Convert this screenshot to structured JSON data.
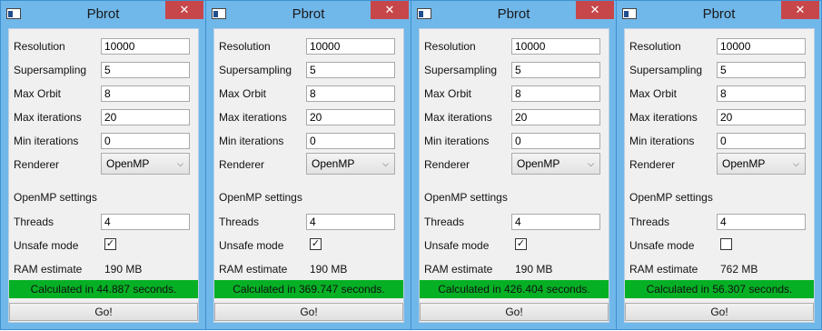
{
  "colors": {
    "titlebar": "#70b7ea",
    "close": "#c7464a",
    "progress": "#06b025"
  },
  "labels": {
    "resolution": "Resolution",
    "supersampling": "Supersampling",
    "max_orbit": "Max Orbit",
    "max_iterations": "Max iterations",
    "min_iterations": "Min iterations",
    "renderer": "Renderer",
    "openmp_settings": "OpenMP settings",
    "threads": "Threads",
    "unsafe_mode": "Unsafe mode",
    "ram_estimate": "RAM estimate",
    "go": "Go!"
  },
  "windows": [
    {
      "title": "Pbrot",
      "close_glyph": "✕",
      "resolution": "10000",
      "supersampling": "5",
      "max_orbit": "8",
      "max_iterations": "20",
      "min_iterations": "0",
      "renderer": "OpenMP",
      "threads": "4",
      "unsafe_checked": true,
      "unsafe_glyph": "✓",
      "ram": "190 MB",
      "status": "Calculated in 44.887 seconds.",
      "progress": 1.0
    },
    {
      "title": "Pbrot",
      "close_glyph": "✕",
      "resolution": "10000",
      "supersampling": "5",
      "max_orbit": "8",
      "max_iterations": "20",
      "min_iterations": "0",
      "renderer": "OpenMP",
      "threads": "4",
      "unsafe_checked": true,
      "unsafe_glyph": "✓",
      "ram": "190 MB",
      "status": "Calculated in 369.747 seconds.",
      "progress": 1.0
    },
    {
      "title": "Pbrot",
      "close_glyph": "✕",
      "resolution": "10000",
      "supersampling": "5",
      "max_orbit": "8",
      "max_iterations": "20",
      "min_iterations": "0",
      "renderer": "OpenMP",
      "threads": "4",
      "unsafe_checked": true,
      "unsafe_glyph": "✓",
      "ram": "190 MB",
      "status": "Calculated in 426.404 seconds.",
      "progress": 1.0
    },
    {
      "title": "Pbrot",
      "close_glyph": "✕",
      "resolution": "10000",
      "supersampling": "5",
      "max_orbit": "8",
      "max_iterations": "20",
      "min_iterations": "0",
      "renderer": "OpenMP",
      "threads": "4",
      "unsafe_checked": false,
      "unsafe_glyph": "",
      "ram": "762 MB",
      "status": "Calculated in 56.307 seconds.",
      "progress": 1.0
    }
  ]
}
